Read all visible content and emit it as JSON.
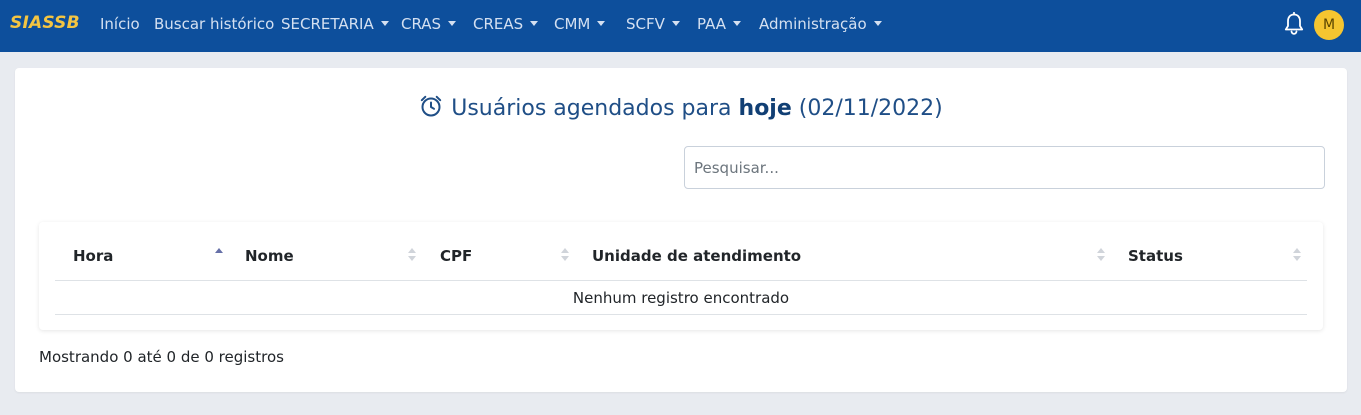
{
  "navbar": {
    "brand": "SIASSB",
    "items": [
      {
        "label": "Início",
        "dropdown": false
      },
      {
        "label": "Buscar histórico",
        "dropdown": false
      },
      {
        "label": "SECRETARIA",
        "dropdown": true
      },
      {
        "label": "CRAS",
        "dropdown": true
      },
      {
        "label": "CREAS",
        "dropdown": true
      },
      {
        "label": "CMM",
        "dropdown": true
      },
      {
        "label": "SCFV",
        "dropdown": true
      },
      {
        "label": "PAA",
        "dropdown": true
      },
      {
        "label": "Administração",
        "dropdown": true
      }
    ],
    "notification_icon": "bell-icon",
    "avatar_initial": "M",
    "colors": {
      "background": "#0d4f9c",
      "brand": "#f4c542",
      "avatar": "#f5c530"
    }
  },
  "page": {
    "title_icon": "alarm-clock-icon",
    "title_prefix": "Usuários agendados para",
    "title_bold": "hoje",
    "title_date": "(02/11/2022)",
    "search_placeholder": "Pesquisar...",
    "table": {
      "columns": [
        {
          "label": "Hora",
          "sorted": "asc"
        },
        {
          "label": "Nome",
          "sorted": "none"
        },
        {
          "label": "CPF",
          "sorted": "none"
        },
        {
          "label": "Unidade de atendimento",
          "sorted": "none"
        },
        {
          "label": "Status",
          "sorted": "none"
        }
      ],
      "rows": [],
      "empty_message": "Nenhum registro encontrado"
    },
    "info_text": "Mostrando 0 até 0 de 0 registros"
  }
}
